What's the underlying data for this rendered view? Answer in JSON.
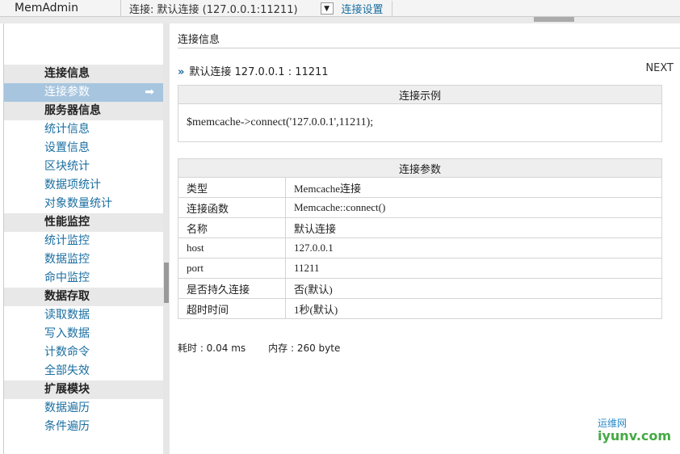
{
  "topbar": {
    "brand": "MemAdmin",
    "connection": "连接: 默认连接 (127.0.0.1:11211)",
    "dropdown_icon": "▼",
    "settings_link": "连接设置"
  },
  "sidebar": {
    "items": [
      {
        "type": "group",
        "label": "连接信息"
      },
      {
        "type": "item",
        "label": "连接参数",
        "active": true
      },
      {
        "type": "group",
        "label": "服务器信息"
      },
      {
        "type": "item",
        "label": "统计信息"
      },
      {
        "type": "item",
        "label": "设置信息"
      },
      {
        "type": "item",
        "label": "区块统计"
      },
      {
        "type": "item",
        "label": "数据项统计"
      },
      {
        "type": "item",
        "label": "对象数量统计"
      },
      {
        "type": "group",
        "label": "性能监控"
      },
      {
        "type": "item",
        "label": "统计监控"
      },
      {
        "type": "item",
        "label": "数据监控"
      },
      {
        "type": "item",
        "label": "命中监控"
      },
      {
        "type": "group",
        "label": "数据存取"
      },
      {
        "type": "item",
        "label": "读取数据"
      },
      {
        "type": "item",
        "label": "写入数据"
      },
      {
        "type": "item",
        "label": "计数命令"
      },
      {
        "type": "item",
        "label": "全部失效"
      },
      {
        "type": "group",
        "label": "扩展模块"
      },
      {
        "type": "item",
        "label": "数据遍历"
      },
      {
        "type": "item",
        "label": "条件遍历"
      }
    ],
    "active_arrow": "➡"
  },
  "main": {
    "title": "连接信息",
    "crumb_icon": "»",
    "crumb": "默认连接 127.0.0.1 : 11211",
    "next": "NEXT",
    "example": {
      "header": "连接示例",
      "code": "$memcache->connect('127.0.0.1',11211);"
    },
    "params": {
      "header": "连接参数",
      "rows": [
        [
          "类型",
          "Memcache连接"
        ],
        [
          "连接函数",
          "Memcache::connect()"
        ],
        [
          "名称",
          "默认连接"
        ],
        [
          "host",
          "127.0.0.1"
        ],
        [
          "port",
          "11211"
        ],
        [
          "是否持久连接",
          "否(默认)"
        ],
        [
          "超时时间",
          "1秒(默认)"
        ]
      ]
    },
    "stats": {
      "time": "耗时 : 0.04 ms",
      "memory": "内存 : 260 byte"
    }
  },
  "watermark": {
    "cn": "运维网",
    "en": "iyunv.com"
  }
}
